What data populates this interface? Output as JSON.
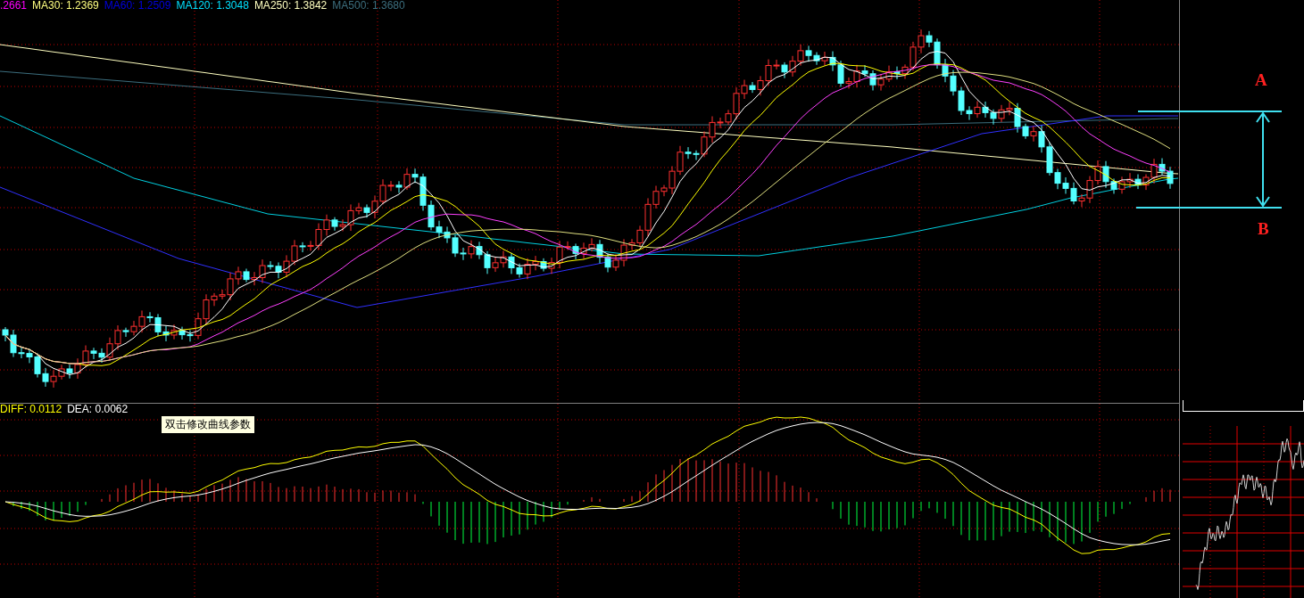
{
  "price_panel": {
    "legend": [
      {
        "text": ".2661",
        "color": "#ff00ff"
      },
      {
        "text": "MA30: 1.2369",
        "color": "#ffff80"
      },
      {
        "text": "MA60: 1.2509",
        "color": "#0000e0"
      },
      {
        "text": "MA120: 1.3048",
        "color": "#00e0ff"
      },
      {
        "text": "MA250: 1.3842",
        "color": "#ffffc0"
      },
      {
        "text": "MA500: 1.3680",
        "color": "#3c6e7e"
      }
    ]
  },
  "range_annotation": {
    "top_label": "A",
    "bottom_label": "B"
  },
  "macd_panel": {
    "legend": [
      {
        "text": "DIFF: 0.0112",
        "color": "#ffff00"
      },
      {
        "text": "DEA: 0.0062",
        "color": "#ffffff"
      }
    ],
    "tooltip": "双击修改曲线参数"
  }
}
